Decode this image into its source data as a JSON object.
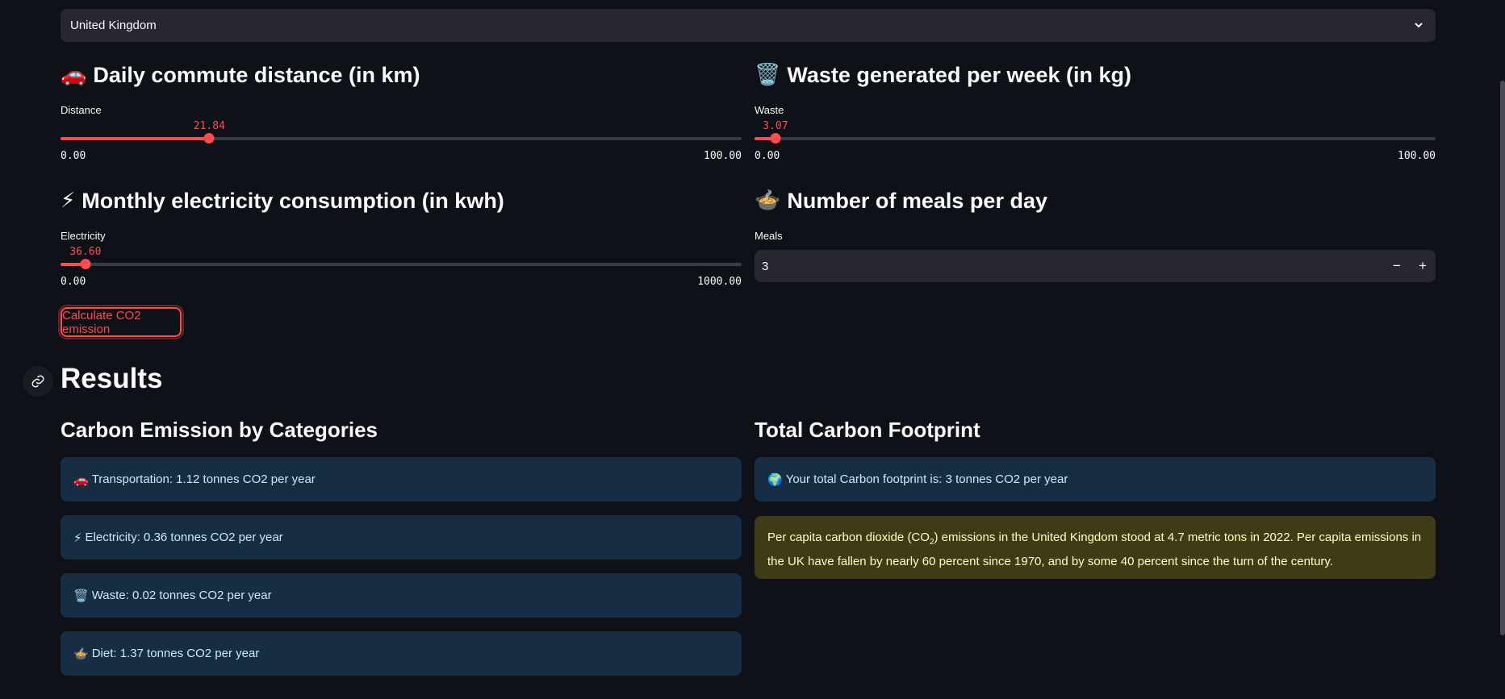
{
  "country_select": {
    "value": "United Kingdom"
  },
  "commute": {
    "heading": "Daily commute distance (in km)",
    "icon": "🚗",
    "label": "Distance",
    "value": 21.84,
    "value_text": "21.84",
    "min": "0.00",
    "max": "100.00",
    "max_value": 100
  },
  "waste": {
    "heading": "Waste generated per week (in kg)",
    "icon": "🗑️",
    "label": "Waste",
    "value": 3.07,
    "value_text": "3.07",
    "min": "0.00",
    "max": "100.00",
    "max_value": 100
  },
  "electricity": {
    "heading": "Monthly electricity consumption (in kwh)",
    "icon": "⚡",
    "label": "Electricity",
    "value": 36.6,
    "value_text": "36.60",
    "min": "0.00",
    "max": "1000.00",
    "max_value": 1000
  },
  "meals": {
    "heading": "Number of meals per day",
    "icon": "🍲",
    "label": "Meals",
    "value": "3",
    "decrement": "−",
    "increment": "+"
  },
  "calculate_button": "Calculate CO2 emission",
  "results": {
    "title": "Results",
    "categories_title": "Carbon Emission by Categories",
    "total_title": "Total Carbon Footprint",
    "items": [
      {
        "icon": "🚗",
        "text": "Transportation: 1.12 tonnes CO2 per year"
      },
      {
        "icon": "⚡",
        "text": "Electricity: 0.36 tonnes CO2 per year"
      },
      {
        "icon": "🗑️",
        "text": "Waste: 0.02 tonnes CO2 per year"
      },
      {
        "icon": "🍲",
        "text": "Diet: 1.37 tonnes CO2 per year"
      }
    ],
    "total": {
      "icon": "🌍",
      "text": "Your total Carbon footprint is: 3 tonnes CO2 per year"
    },
    "note": {
      "before": "Per capita carbon dioxide (CO",
      "sub": "2",
      "after": ") emissions in the United Kingdom stood at 4.7 metric tons in 2022. Per capita emissions in the UK have fallen by nearly 60 percent since 1970, and by some 40 percent since the turn of the century."
    }
  },
  "colors": {
    "background": "#0e1117",
    "accent": "#ff4b4b",
    "info_bg": "#172d43",
    "warning_bg": "#3e3b16"
  }
}
